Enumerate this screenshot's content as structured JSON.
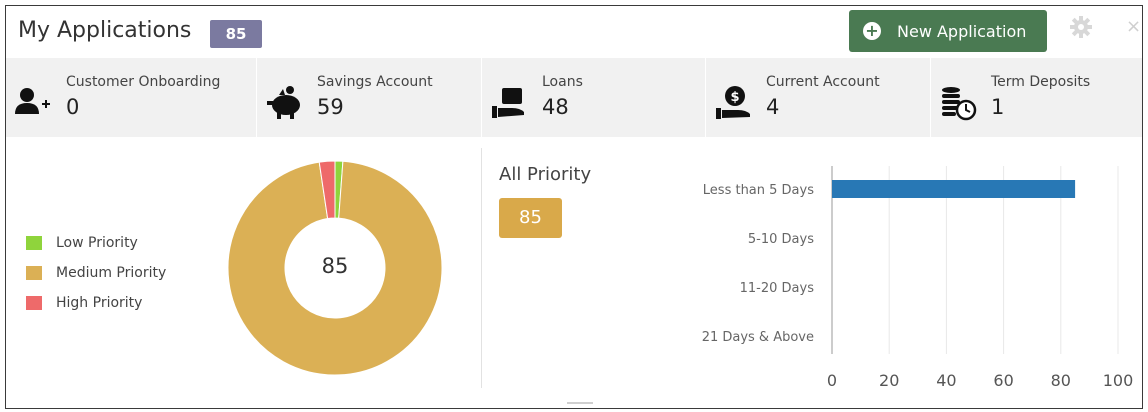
{
  "header": {
    "title": "My Applications",
    "count": "85",
    "new_button_label": "New Application",
    "close_glyph": "×"
  },
  "categories": [
    {
      "label": "Customer Onboarding",
      "value": "0",
      "icon": "add-user-icon"
    },
    {
      "label": "Savings Account",
      "value": "59",
      "icon": "piggy-bank-icon"
    },
    {
      "label": "Loans",
      "value": "48",
      "icon": "wallet-hand-icon"
    },
    {
      "label": "Current Account",
      "value": "4",
      "icon": "coin-hand-icon"
    },
    {
      "label": "Term Deposits",
      "value": "1",
      "icon": "coin-stack-clock-icon"
    }
  ],
  "priority_legend": [
    {
      "label": "Low Priority",
      "color": "#8fd43c"
    },
    {
      "label": "Medium Priority",
      "color": "#dbb055"
    },
    {
      "label": "High Priority",
      "color": "#ee6a6a"
    }
  ],
  "donut_center": "85",
  "all_priority": {
    "label": "All Priority",
    "value": "85"
  },
  "chart_data": [
    {
      "type": "pie",
      "categories": [
        "Low Priority",
        "Medium Priority",
        "High Priority"
      ],
      "values": [
        1,
        82,
        2
      ],
      "colors": [
        "#8fd43c",
        "#dbb055",
        "#ee6a6a"
      ],
      "center_label": "85",
      "donut": true
    },
    {
      "type": "bar",
      "orientation": "horizontal",
      "categories": [
        "Less than 5 Days",
        "5-10 Days",
        "11-20 Days",
        "21 Days & Above"
      ],
      "values": [
        85,
        0,
        0,
        0
      ],
      "xlim": [
        0,
        100
      ],
      "xticks": [
        0,
        20,
        40,
        60,
        80,
        100
      ],
      "grid": true,
      "bar_color": "#2878b5"
    }
  ]
}
